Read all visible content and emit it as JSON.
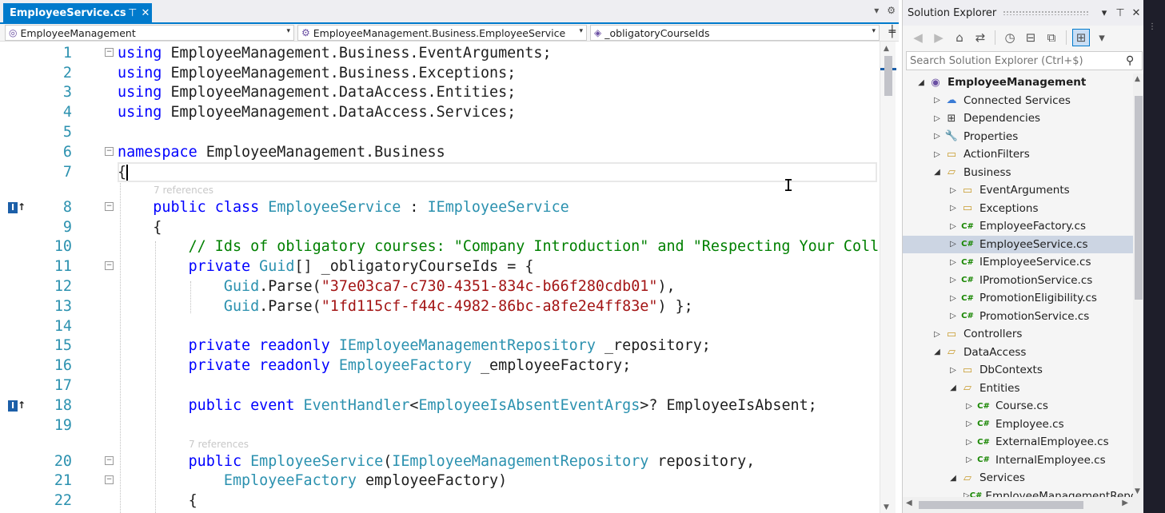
{
  "editor": {
    "tab": {
      "label": "EmployeeService.cs",
      "pin_glyph": "⊤",
      "close_glyph": "✕"
    },
    "tab_strip_glyphs": {
      "dropdown": "▾",
      "settings": "⚙"
    },
    "nav": {
      "project": "EmployeeManagement",
      "type": "EmployeeManagement.Business.EmployeeService",
      "member": "_obligatoryCourseIds",
      "arrow": "▾",
      "split_glyph": "╪"
    },
    "codelens": {
      "class_refs": "7 references",
      "ctor_refs": "7 references"
    },
    "gutter_mark": {
      "box": "I",
      "arrow": "↑"
    },
    "fold_glyph": "−",
    "lines": [
      {
        "n": "1",
        "tokens": [
          [
            "kw",
            "using"
          ],
          [
            "tx",
            " EmployeeManagement.Business.EventArguments;"
          ]
        ]
      },
      {
        "n": "2",
        "tokens": [
          [
            "kw",
            "using"
          ],
          [
            "tx",
            " EmployeeManagement.Business.Exceptions;"
          ]
        ]
      },
      {
        "n": "3",
        "tokens": [
          [
            "kw",
            "using"
          ],
          [
            "tx",
            " EmployeeManagement.DataAccess.Entities;"
          ]
        ]
      },
      {
        "n": "4",
        "tokens": [
          [
            "kw",
            "using"
          ],
          [
            "tx",
            " EmployeeManagement.DataAccess.Services;"
          ]
        ]
      },
      {
        "n": "5",
        "tokens": []
      },
      {
        "n": "6",
        "tokens": [
          [
            "kw",
            "namespace"
          ],
          [
            "tx",
            " EmployeeManagement.Business"
          ]
        ]
      },
      {
        "n": "7",
        "tokens": [
          [
            "tx",
            "{"
          ]
        ]
      },
      {
        "n": "8",
        "tokens": [
          [
            "tx",
            "    "
          ],
          [
            "kw",
            "public class"
          ],
          [
            "tx",
            " "
          ],
          [
            "ty",
            "EmployeeService"
          ],
          [
            "tx",
            " : "
          ],
          [
            "ty",
            "IEmployeeService"
          ]
        ]
      },
      {
        "n": "9",
        "tokens": [
          [
            "tx",
            "    {"
          ]
        ]
      },
      {
        "n": "10",
        "tokens": [
          [
            "tx",
            "        "
          ],
          [
            "cm",
            "// Ids of obligatory courses: \"Company Introduction\" and \"Respecting Your Colleagues\""
          ]
        ]
      },
      {
        "n": "11",
        "tokens": [
          [
            "tx",
            "        "
          ],
          [
            "kw",
            "private"
          ],
          [
            "tx",
            " "
          ],
          [
            "ty",
            "Guid"
          ],
          [
            "tx",
            "[] _obligatoryCourseIds = {"
          ]
        ]
      },
      {
        "n": "12",
        "tokens": [
          [
            "tx",
            "            "
          ],
          [
            "ty",
            "Guid"
          ],
          [
            "tx",
            ".Parse("
          ],
          [
            "st",
            "\"37e03ca7-c730-4351-834c-b66f280cdb01\""
          ],
          [
            "tx",
            "),"
          ]
        ]
      },
      {
        "n": "13",
        "tokens": [
          [
            "tx",
            "            "
          ],
          [
            "ty",
            "Guid"
          ],
          [
            "tx",
            ".Parse("
          ],
          [
            "st",
            "\"1fd115cf-f44c-4982-86bc-a8fe2e4ff83e\""
          ],
          [
            "tx",
            ") };"
          ]
        ]
      },
      {
        "n": "14",
        "tokens": []
      },
      {
        "n": "15",
        "tokens": [
          [
            "tx",
            "        "
          ],
          [
            "kw",
            "private readonly"
          ],
          [
            "tx",
            " "
          ],
          [
            "ty",
            "IEmployeeManagementRepository"
          ],
          [
            "tx",
            " _repository;"
          ]
        ]
      },
      {
        "n": "16",
        "tokens": [
          [
            "tx",
            "        "
          ],
          [
            "kw",
            "private readonly"
          ],
          [
            "tx",
            " "
          ],
          [
            "ty",
            "EmployeeFactory"
          ],
          [
            "tx",
            " _employeeFactory;"
          ]
        ]
      },
      {
        "n": "17",
        "tokens": []
      },
      {
        "n": "18",
        "tokens": [
          [
            "tx",
            "        "
          ],
          [
            "kw",
            "public event"
          ],
          [
            "tx",
            " "
          ],
          [
            "ty",
            "EventHandler"
          ],
          [
            "tx",
            "<"
          ],
          [
            "ty",
            "EmployeeIsAbsentEventArgs"
          ],
          [
            "tx",
            ">? EmployeeIsAbsent;"
          ]
        ]
      },
      {
        "n": "19",
        "tokens": []
      },
      {
        "n": "20",
        "tokens": [
          [
            "tx",
            "        "
          ],
          [
            "kw",
            "public"
          ],
          [
            "tx",
            " "
          ],
          [
            "ty",
            "EmployeeService"
          ],
          [
            "tx",
            "("
          ],
          [
            "ty",
            "IEmployeeManagementRepository"
          ],
          [
            "tx",
            " repository,"
          ]
        ]
      },
      {
        "n": "21",
        "tokens": [
          [
            "tx",
            "            "
          ],
          [
            "ty",
            "EmployeeFactory"
          ],
          [
            "tx",
            " employeeFactory)"
          ]
        ]
      },
      {
        "n": "22",
        "tokens": [
          [
            "tx",
            "        {"
          ]
        ]
      }
    ]
  },
  "solution_explorer": {
    "title": "Solution Explorer",
    "title_buttons": {
      "dropdown": "▾",
      "pin": "🖈",
      "close": "✕"
    },
    "toolbar": {
      "back": "◀",
      "forward": "▶",
      "home": "⌂",
      "switch": "⇄",
      "history": "◷",
      "collapse": "⊟",
      "sync": "⧉",
      "properties": "⊞",
      "more": "▾"
    },
    "search_placeholder": "Search Solution Explorer (Ctrl+$)",
    "search_icon": "⚲",
    "tree": [
      {
        "label": "EmployeeManagement",
        "level": 0,
        "expanded": true,
        "icon": "project",
        "bold": true
      },
      {
        "label": "Connected Services",
        "level": 1,
        "expanded": false,
        "icon": "cloud"
      },
      {
        "label": "Dependencies",
        "level": 1,
        "expanded": false,
        "icon": "dependencies"
      },
      {
        "label": "Properties",
        "level": 1,
        "expanded": false,
        "icon": "properties"
      },
      {
        "label": "ActionFilters",
        "level": 1,
        "expanded": false,
        "icon": "folder"
      },
      {
        "label": "Business",
        "level": 1,
        "expanded": true,
        "icon": "folder-open"
      },
      {
        "label": "EventArguments",
        "level": 2,
        "expanded": false,
        "icon": "folder"
      },
      {
        "label": "Exceptions",
        "level": 2,
        "expanded": false,
        "icon": "folder"
      },
      {
        "label": "EmployeeFactory.cs",
        "level": 2,
        "expanded": false,
        "icon": "csharp"
      },
      {
        "label": "EmployeeService.cs",
        "level": 2,
        "expanded": false,
        "icon": "csharp",
        "selected": true
      },
      {
        "label": "IEmployeeService.cs",
        "level": 2,
        "expanded": false,
        "icon": "csharp"
      },
      {
        "label": "IPromotionService.cs",
        "level": 2,
        "expanded": false,
        "icon": "csharp"
      },
      {
        "label": "PromotionEligibility.cs",
        "level": 2,
        "expanded": false,
        "icon": "csharp"
      },
      {
        "label": "PromotionService.cs",
        "level": 2,
        "expanded": false,
        "icon": "csharp"
      },
      {
        "label": "Controllers",
        "level": 1,
        "expanded": false,
        "icon": "folder"
      },
      {
        "label": "DataAccess",
        "level": 1,
        "expanded": true,
        "icon": "folder-open"
      },
      {
        "label": "DbContexts",
        "level": 2,
        "expanded": false,
        "icon": "folder"
      },
      {
        "label": "Entities",
        "level": 2,
        "expanded": true,
        "icon": "folder-open"
      },
      {
        "label": "Course.cs",
        "level": 3,
        "expanded": false,
        "icon": "csharp"
      },
      {
        "label": "Employee.cs",
        "level": 3,
        "expanded": false,
        "icon": "csharp"
      },
      {
        "label": "ExternalEmployee.cs",
        "level": 3,
        "expanded": false,
        "icon": "csharp"
      },
      {
        "label": "InternalEmployee.cs",
        "level": 3,
        "expanded": false,
        "icon": "csharp"
      },
      {
        "label": "Services",
        "level": 2,
        "expanded": true,
        "icon": "folder-open"
      },
      {
        "label": "EmployeeManagementRepository.cs",
        "level": 3,
        "expanded": false,
        "icon": "csharp"
      }
    ]
  },
  "colors": {
    "accent": "#007acc",
    "keyword": "#0000ff",
    "type": "#2b91af",
    "string": "#a31515",
    "comment": "#008000",
    "selected_row": "#ccd5e3"
  }
}
